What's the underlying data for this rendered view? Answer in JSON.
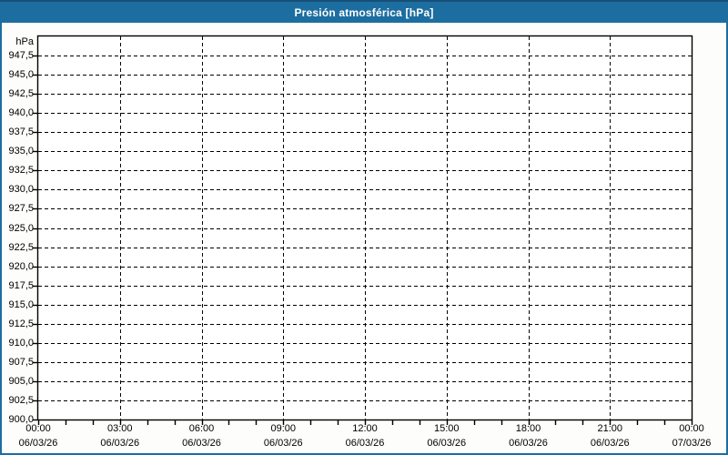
{
  "title": "Presión atmosférica [hPa]",
  "y_axis_unit_label": "hPa",
  "colors": {
    "titlebar_bg": "#1d6ea0",
    "titlebar_top_edge": "#174f77",
    "panel_border": "#1d6ea0",
    "panel_bg": "#fdfefb",
    "plot_bg": "#ffffff",
    "grid": "#000000",
    "axis": "#000000",
    "tick": "#000000",
    "label_text": "#000000",
    "title_text": "#ffffff"
  },
  "chart_data": {
    "type": "line",
    "title": "Presión atmosférica [hPa]",
    "ylabel": "hPa",
    "ylim": [
      900,
      950
    ],
    "y_tick_step": 2.5,
    "y_tick_labels": [
      "947,5",
      "945,0",
      "942,5",
      "940,0",
      "937,5",
      "935,0",
      "932,5",
      "930,0",
      "927,5",
      "925,0",
      "922,5",
      "920,0",
      "917,5",
      "915,0",
      "912,5",
      "910,0",
      "907,5",
      "905,0",
      "902,5",
      "900,0"
    ],
    "x_range_hours": 24,
    "x_major_step_hours": 3,
    "x_minor_step_hours": 1,
    "x_tick_labels": [
      {
        "time": "00:00",
        "date": "06/03/26"
      },
      {
        "time": "03:00",
        "date": "06/03/26"
      },
      {
        "time": "06:00",
        "date": "06/03/26"
      },
      {
        "time": "09:00",
        "date": "06/03/26"
      },
      {
        "time": "12:00",
        "date": "06/03/26"
      },
      {
        "time": "15:00",
        "date": "06/03/26"
      },
      {
        "time": "18:00",
        "date": "06/03/26"
      },
      {
        "time": "21:00",
        "date": "06/03/26"
      },
      {
        "time": "00:00",
        "date": "07/03/26"
      }
    ],
    "grid": "dashed",
    "legend": "none",
    "series": []
  }
}
